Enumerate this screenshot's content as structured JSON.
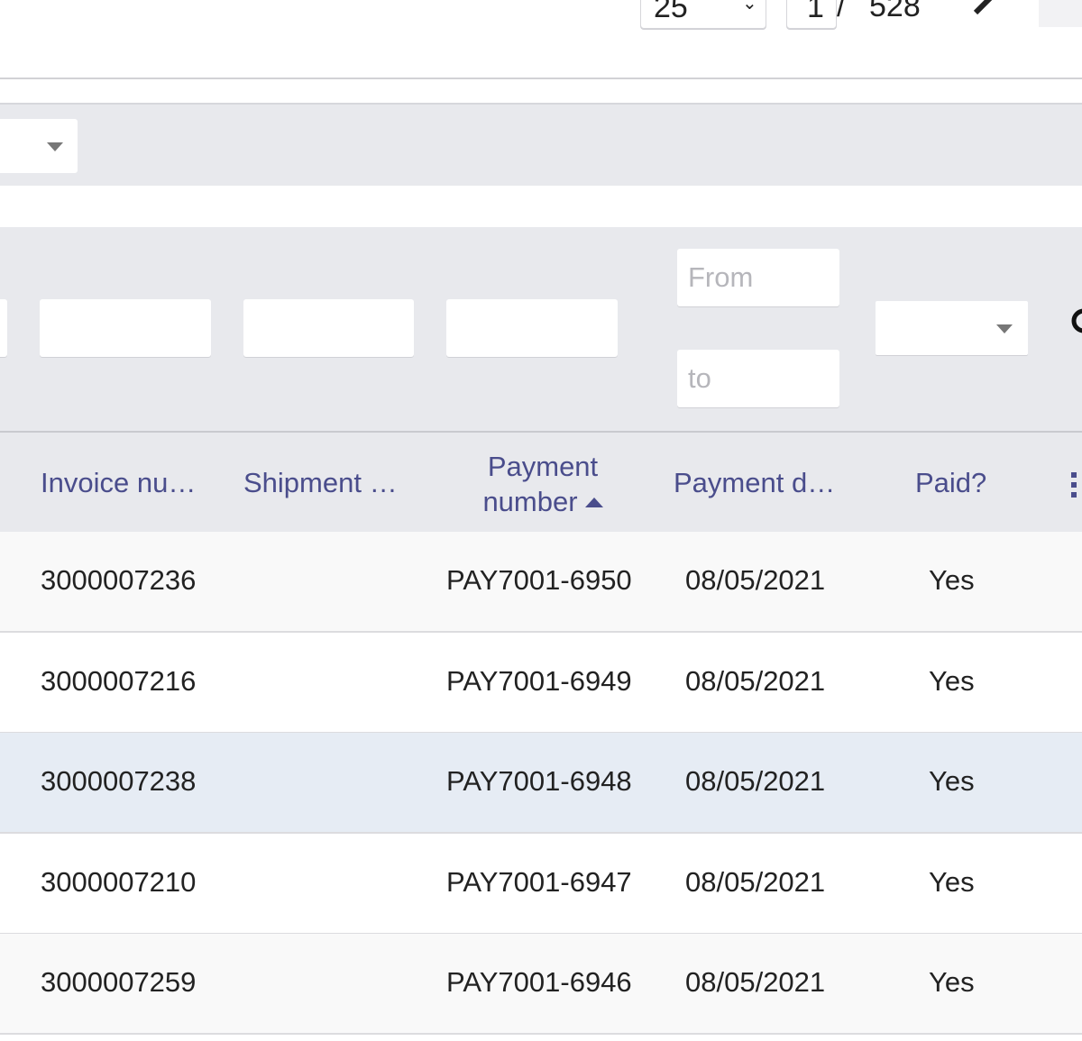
{
  "pagination": {
    "page_size": "25",
    "current_page": "1",
    "separator": "/",
    "total_pages": "528"
  },
  "filters": {
    "date_from_placeholder": "From",
    "date_to_placeholder": "to"
  },
  "table": {
    "columns": [
      "Invoice nu…",
      "Shipment …",
      "Payment number",
      "Payment d…",
      "Paid?"
    ],
    "sorted_column": "Payment number",
    "sort_direction": "ascending",
    "rows": [
      {
        "invoice": "3000007236",
        "shipment": "",
        "payment": "PAY7001-6950",
        "date": "08/05/2021",
        "paid": "Yes"
      },
      {
        "invoice": "3000007216",
        "shipment": "",
        "payment": "PAY7001-6949",
        "date": "08/05/2021",
        "paid": "Yes"
      },
      {
        "invoice": "3000007238",
        "shipment": "",
        "payment": "PAY7001-6948",
        "date": "08/05/2021",
        "paid": "Yes"
      },
      {
        "invoice": "3000007210",
        "shipment": "",
        "payment": "PAY7001-6947",
        "date": "08/05/2021",
        "paid": "Yes"
      },
      {
        "invoice": "3000007259",
        "shipment": "",
        "payment": "PAY7001-6946",
        "date": "08/05/2021",
        "paid": "Yes"
      }
    ]
  },
  "colors": {
    "header_text": "#4a4d8c",
    "band_bg": "#e8e9ed",
    "highlight_row": "#e6ecf4"
  }
}
